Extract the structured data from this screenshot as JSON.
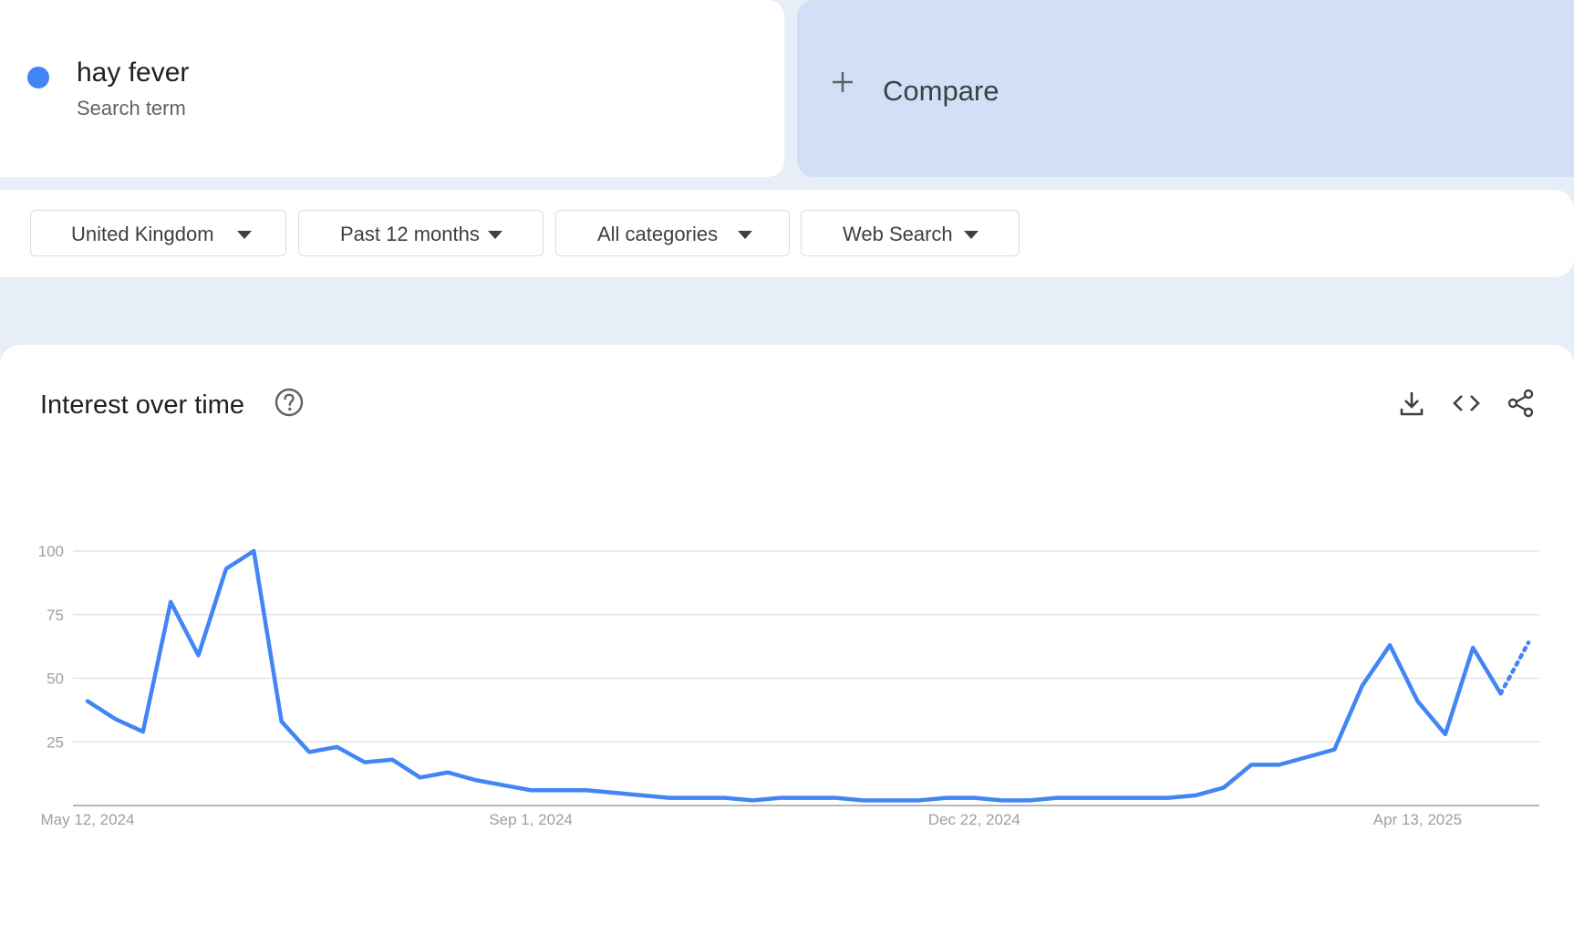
{
  "term": {
    "name": "hay fever",
    "subtitle": "Search term",
    "color": "#4285f4"
  },
  "compare": {
    "label": "Compare",
    "icon": "plus-icon"
  },
  "filters": [
    {
      "label": "United Kingdom",
      "icon": "caret-down-icon"
    },
    {
      "label": "Past 12 months",
      "icon": "caret-down-icon"
    },
    {
      "label": "All categories",
      "icon": "caret-down-icon"
    },
    {
      "label": "Web Search",
      "icon": "caret-down-icon"
    }
  ],
  "panel": {
    "title": "Interest over time",
    "help_icon": "help-circle-icon",
    "tools": [
      "download-icon",
      "embed-code-icon",
      "share-icon"
    ]
  },
  "chart_data": {
    "type": "line",
    "title": "",
    "xlabel": "",
    "ylabel": "",
    "ylim": [
      0,
      100
    ],
    "y_ticks": [
      25,
      50,
      75,
      100
    ],
    "x_tick_labels": [
      "May 12, 2024",
      "Sep 1, 2024",
      "Dec 22, 2024",
      "Apr 13, 2025"
    ],
    "x_tick_weeks": [
      0,
      16,
      32,
      48
    ],
    "grid": true,
    "series": [
      {
        "color": "#4285f4",
        "values": [
          41,
          34,
          29,
          80,
          59,
          93,
          100,
          33,
          21,
          23,
          17,
          18,
          11,
          13,
          10,
          8,
          6,
          6,
          6,
          5,
          4,
          3,
          3,
          3,
          2,
          3,
          3,
          3,
          2,
          2,
          2,
          3,
          3,
          2,
          2,
          3,
          3,
          3,
          3,
          3,
          4,
          7,
          16,
          16,
          19,
          22,
          47,
          63,
          41,
          28,
          62,
          44,
          64
        ],
        "partial_from_index": 51
      }
    ]
  }
}
